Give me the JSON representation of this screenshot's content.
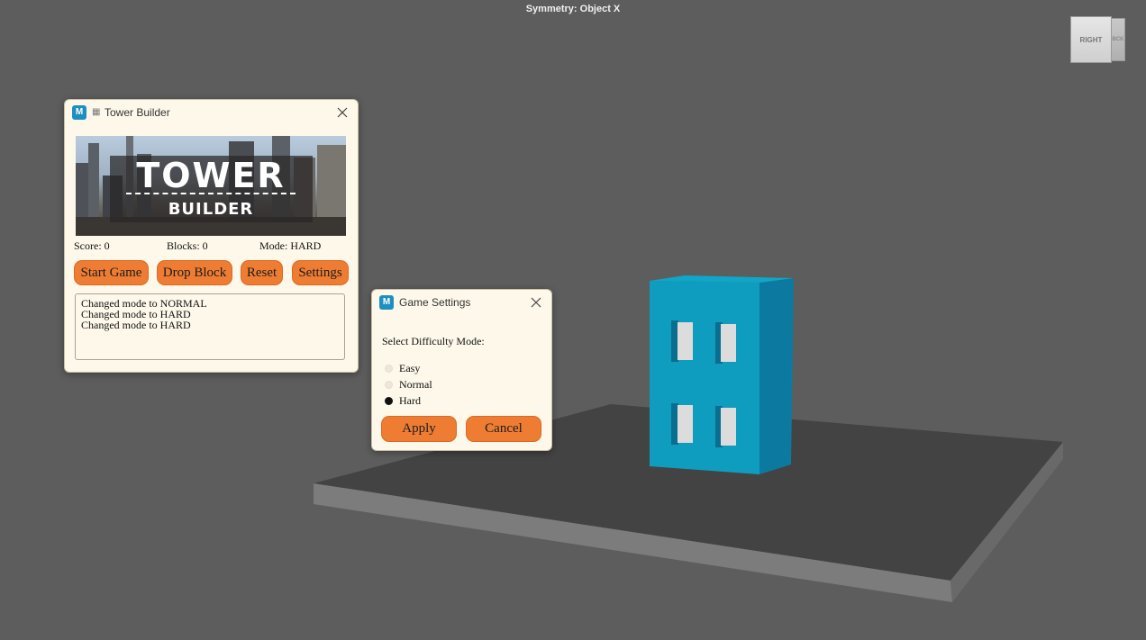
{
  "viewport": {
    "symmetry_label": "Symmetry: Object X",
    "viewcube_front": "RIGHT",
    "viewcube_side": "BCK"
  },
  "tower_window": {
    "title": "Tower Builder",
    "banner_line1": "TOWER",
    "banner_line2": "BUILDER",
    "score_label": "Score: 0",
    "blocks_label": "Blocks: 0",
    "mode_label": "Mode: HARD",
    "buttons": {
      "start": "Start Game",
      "drop": "Drop Block",
      "reset": "Reset",
      "settings": "Settings"
    },
    "log_lines": [
      "Changed mode to NORMAL",
      "Changed mode to HARD",
      "Changed mode to HARD"
    ]
  },
  "settings_window": {
    "title": "Game Settings",
    "prompt": "Select Difficulty Mode:",
    "options": [
      "Easy",
      "Normal",
      "Hard"
    ],
    "selected": "Hard",
    "apply_label": "Apply",
    "cancel_label": "Cancel"
  },
  "colors": {
    "viewport_bg": "#5d5d5d",
    "window_bg": "#fdf8ea",
    "button_orange": "#ee7d33",
    "building_cyan": "#0e9dbf"
  }
}
